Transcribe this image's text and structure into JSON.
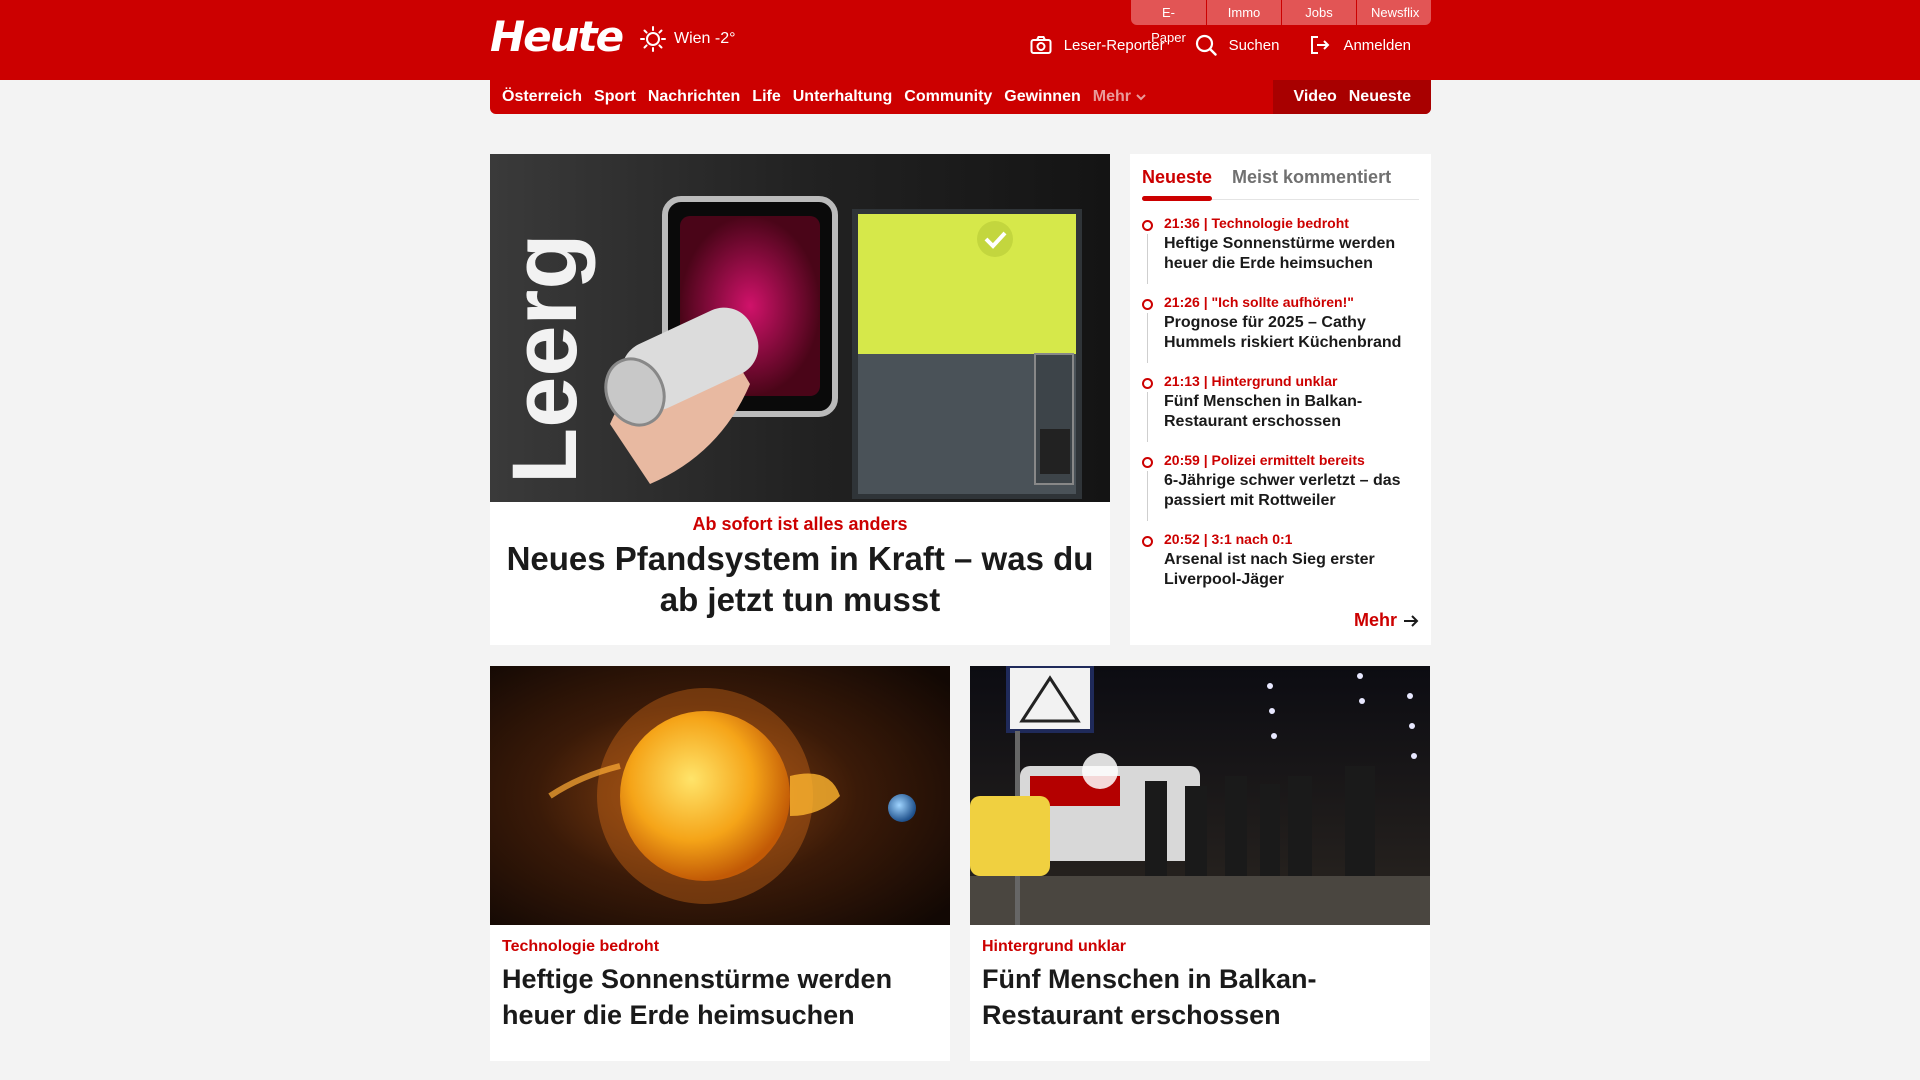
{
  "header": {
    "logo_text": "Heute",
    "weather": "Wien -2°",
    "quicklinks": [
      "E-Paper",
      "Immo",
      "Jobs",
      "Newsflix"
    ],
    "tools": {
      "reporter": "Leser-Reporter",
      "search": "Suchen",
      "login": "Anmelden"
    }
  },
  "nav": {
    "items": [
      "Österreich",
      "Sport",
      "Nachrichten",
      "Life",
      "Unterhaltung",
      "Community",
      "Gewinnen"
    ],
    "more": "Mehr",
    "right": [
      "Video",
      "Neueste"
    ]
  },
  "hero": {
    "kicker": "Ab sofort ist alles anders",
    "title": "Neues Pfandsystem in Kraft – was du ab jetzt tun musst",
    "image_text": "Leerg"
  },
  "sidebar": {
    "tabs": [
      "Neueste",
      "Meist kommentiert"
    ],
    "items": [
      {
        "meta": "21:36 | Technologie bedroht",
        "title": "Heftige Sonnenstürme werden heuer die Erde heimsuchen"
      },
      {
        "meta": "21:26 | \"Ich sollte aufhören!\"",
        "title": "Prognose für 2025 – Cathy Hummels riskiert Küchenbrand"
      },
      {
        "meta": "21:13 | Hintergrund unklar",
        "title": "Fünf Menschen in Balkan-Restaurant erschossen"
      },
      {
        "meta": "20:59 | Polizei ermittelt bereits",
        "title": "6-Jährige schwer verletzt – das passiert mit Rottweiler"
      },
      {
        "meta": "20:52 | 3:1 nach 0:1",
        "title": "Arsenal ist nach Sieg erster Liverpool-Jäger"
      }
    ],
    "more": "Mehr"
  },
  "cards": [
    {
      "kicker": "Technologie bedroht",
      "title": "Heftige Sonnenstürme werden heuer die Erde heimsuchen"
    },
    {
      "kicker": "Hintergrund unklar",
      "title": "Fünf Menschen in Balkan-Restaurant erschossen"
    }
  ],
  "colors": {
    "brand_red": "#cc0000",
    "dark_red": "#a80000",
    "background": "#f3f3f3"
  }
}
